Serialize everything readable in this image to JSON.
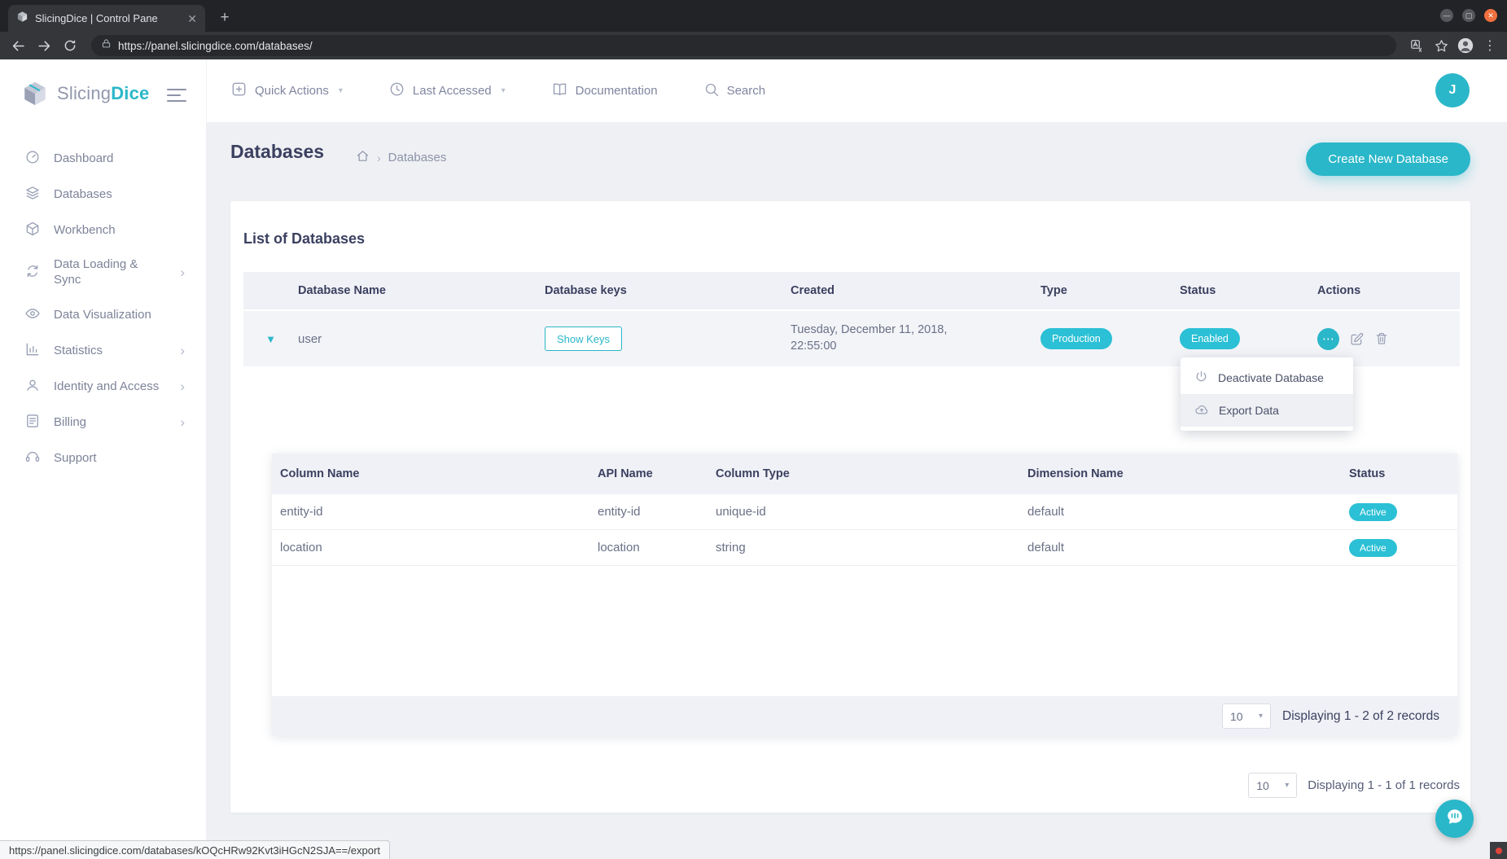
{
  "browser": {
    "tab_title": "SlicingDice | Control Pane",
    "new_tab_label": "+",
    "url": "https://panel.slicingdice.com/databases/",
    "status_url": "https://panel.slicingdice.com/databases/kOQcHRw92Kvt3iHGcN2SJA==/export"
  },
  "sidebar": {
    "logo_slicing": "Slicing",
    "logo_dice": "Dice",
    "items": [
      {
        "label": "Dashboard"
      },
      {
        "label": "Databases"
      },
      {
        "label": "Workbench"
      },
      {
        "label": "Data Loading & Sync"
      },
      {
        "label": "Data Visualization"
      },
      {
        "label": "Statistics"
      },
      {
        "label": "Identity and Access"
      },
      {
        "label": "Billing"
      },
      {
        "label": "Support"
      }
    ]
  },
  "topbar": {
    "quick_actions": "Quick Actions",
    "last_accessed": "Last Accessed",
    "documentation": "Documentation",
    "search": "Search",
    "avatar_initial": "J"
  },
  "page": {
    "title": "Databases",
    "breadcrumb_current": "Databases",
    "create_button": "Create New Database"
  },
  "card": {
    "title": "List of Databases",
    "table": {
      "headers": [
        "Database Name",
        "Database keys",
        "Created",
        "Type",
        "Status",
        "Actions"
      ],
      "row": {
        "name": "user",
        "keys_button": "Show Keys",
        "created_line1": "Tuesday, December 11, 2018,",
        "created_line2": "22:55:00",
        "type_badge": "Production",
        "status_badge": "Enabled"
      }
    },
    "menu": {
      "items": [
        {
          "label": "Deactivate Database"
        },
        {
          "label": "Export Data"
        }
      ]
    },
    "nested": {
      "headers": [
        "Column Name",
        "API Name",
        "Column Type",
        "Dimension Name",
        "Status"
      ],
      "rows": [
        {
          "column_name": "entity-id",
          "api_name": "entity-id",
          "column_type": "unique-id",
          "dimension_name": "default",
          "status": "Active"
        },
        {
          "column_name": "location",
          "api_name": "location",
          "column_type": "string",
          "dimension_name": "default",
          "status": "Active"
        }
      ],
      "pagination": {
        "page_size": "10",
        "summary": "Displaying 1 - 2 of 2 records"
      }
    },
    "pagination": {
      "page_size": "10",
      "summary": "Displaying 1 - 1 of 1 records"
    }
  },
  "colors": {
    "accent": "#2ab7c9",
    "badge": "#2bc0d5"
  }
}
